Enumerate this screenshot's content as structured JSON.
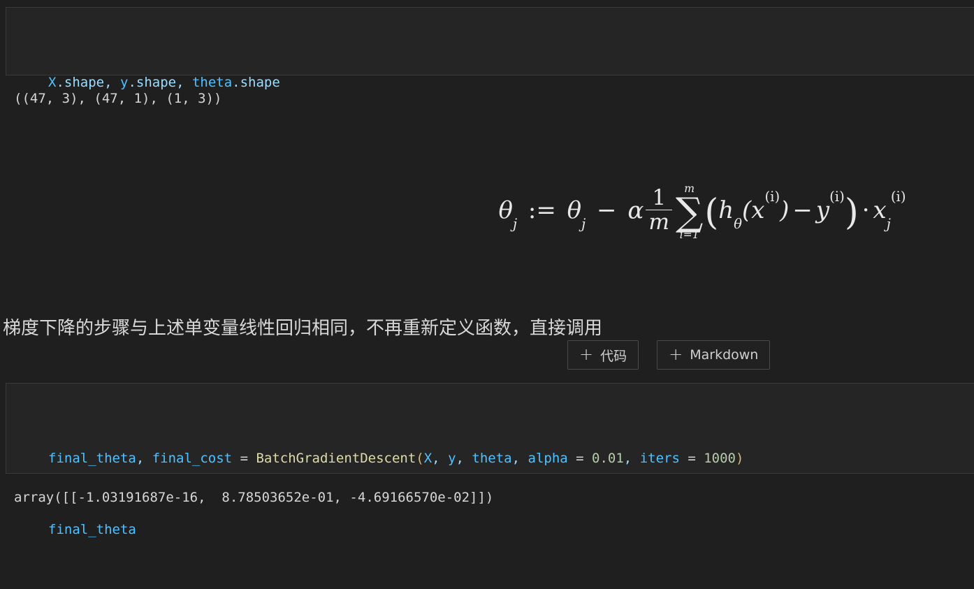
{
  "theme": {
    "page_bg": "#1f1f1f",
    "cell_bg": "#252526",
    "cell_border": "#3a3a3c",
    "text": "#d4d4d4",
    "accent_variable": "#4fc1ff",
    "accent_attribute": "#9cdcfe",
    "accent_function": "#dcdcaa",
    "accent_number": "#b5cea8",
    "accent_paren": "#d7ba7d"
  },
  "cells": [
    {
      "type": "code",
      "name": "shape-inspection-cell",
      "lines": [
        {
          "tokens": [
            {
              "t": "X",
              "c": "tk-var"
            },
            {
              "t": ".shape",
              "c": "tk-attr"
            },
            {
              "t": ", ",
              "c": "tk-punct"
            },
            {
              "t": "y",
              "c": "tk-var"
            },
            {
              "t": ".shape",
              "c": "tk-attr"
            },
            {
              "t": ", ",
              "c": "tk-punct"
            },
            {
              "t": "theta",
              "c": "tk-var"
            },
            {
              "t": ".shape",
              "c": "tk-attr"
            }
          ]
        }
      ]
    }
  ],
  "output_1": {
    "name": "shape-output",
    "text": "((47, 3), (47, 1), (1, 3))"
  },
  "formula": {
    "name": "gradient-descent-formula",
    "latex": "\\theta_j := \\theta_j - \\alpha\\frac{1}{m}\\sum_{i=1}^{m}(h_\\theta(x^{(i)}) - y^{(i)}) \\cdot x_j^{(i)}",
    "parts": {
      "theta": "θ",
      "alpha": "α",
      "assign": ":=",
      "minus": "−",
      "sum_upper": "m",
      "sum_lower": "i=1",
      "sigma": "∑",
      "frac_num": "1",
      "frac_den": "m",
      "h": "h",
      "x": "x",
      "y": "y",
      "sub_j": "j",
      "sup_i": "(i)",
      "cdot": "·"
    }
  },
  "markdown_note": {
    "name": "gradient-descent-note",
    "text": "梯度下降的步骤与上述单变量线性回归相同，不再重新定义函数，直接调用"
  },
  "add_toolbar": {
    "code_button": {
      "plus": "+",
      "label": "代码"
    },
    "markdown_button": {
      "plus": "+",
      "label": "Markdown"
    }
  },
  "cell_2": {
    "name": "batch-gradient-descent-call-cell",
    "line1": [
      {
        "t": "final_theta",
        "c": "tk-var"
      },
      {
        "t": ", ",
        "c": "tk-punct"
      },
      {
        "t": "final_cost",
        "c": "tk-var"
      },
      {
        "t": " ",
        "c": "tk-op"
      },
      {
        "t": "=",
        "c": "tk-op"
      },
      {
        "t": " ",
        "c": "tk-op"
      },
      {
        "t": "BatchGradientDescent",
        "c": "tk-func"
      },
      {
        "t": "(",
        "c": "tk-paren"
      },
      {
        "t": "X",
        "c": "tk-var"
      },
      {
        "t": ", ",
        "c": "tk-punct"
      },
      {
        "t": "y",
        "c": "tk-var"
      },
      {
        "t": ", ",
        "c": "tk-punct"
      },
      {
        "t": "theta",
        "c": "tk-var"
      },
      {
        "t": ", ",
        "c": "tk-punct"
      },
      {
        "t": "alpha",
        "c": "tk-var"
      },
      {
        "t": " = ",
        "c": "tk-op"
      },
      {
        "t": "0.01",
        "c": "tk-num"
      },
      {
        "t": ", ",
        "c": "tk-punct"
      },
      {
        "t": "iters",
        "c": "tk-var"
      },
      {
        "t": " = ",
        "c": "tk-op"
      },
      {
        "t": "1000",
        "c": "tk-num"
      },
      {
        "t": ")",
        "c": "tk-paren"
      }
    ],
    "line2": [
      {
        "t": "final_theta",
        "c": "tk-var"
      }
    ]
  },
  "output_2": {
    "name": "final-theta-output",
    "text": "array([[-1.03191687e-16,  8.78503652e-01, -4.69166570e-02]])"
  }
}
